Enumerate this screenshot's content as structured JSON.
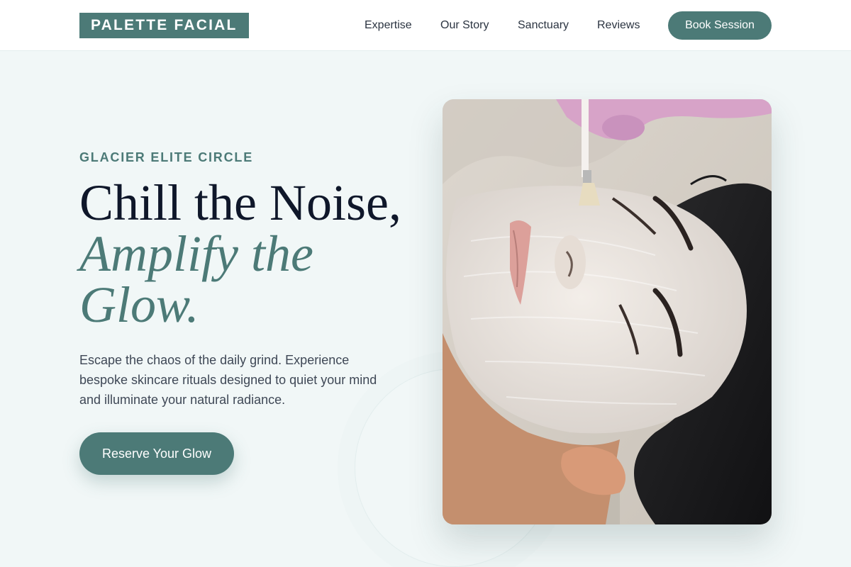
{
  "brand": {
    "name": "PALETTE FACIAL"
  },
  "nav": {
    "items": [
      {
        "label": "Expertise"
      },
      {
        "label": "Our Story"
      },
      {
        "label": "Sanctuary"
      },
      {
        "label": "Reviews"
      }
    ],
    "cta_label": "Book Session"
  },
  "hero": {
    "eyebrow": "GLACIER ELITE CIRCLE",
    "headline_line1": "Chill the Noise,",
    "headline_accent": "Amplify the Glow.",
    "description": "Escape the chaos of the daily grind. Experience bespoke skincare rituals designed to quiet your mind and illuminate your natural radiance.",
    "cta_label": "Reserve Your Glow"
  },
  "image": {
    "subject": "facial-mask-treatment-photo"
  },
  "colors": {
    "accent": "#4c7a77",
    "background": "#f1f7f7",
    "heading": "#0f172a",
    "body_text": "#3f4856"
  }
}
